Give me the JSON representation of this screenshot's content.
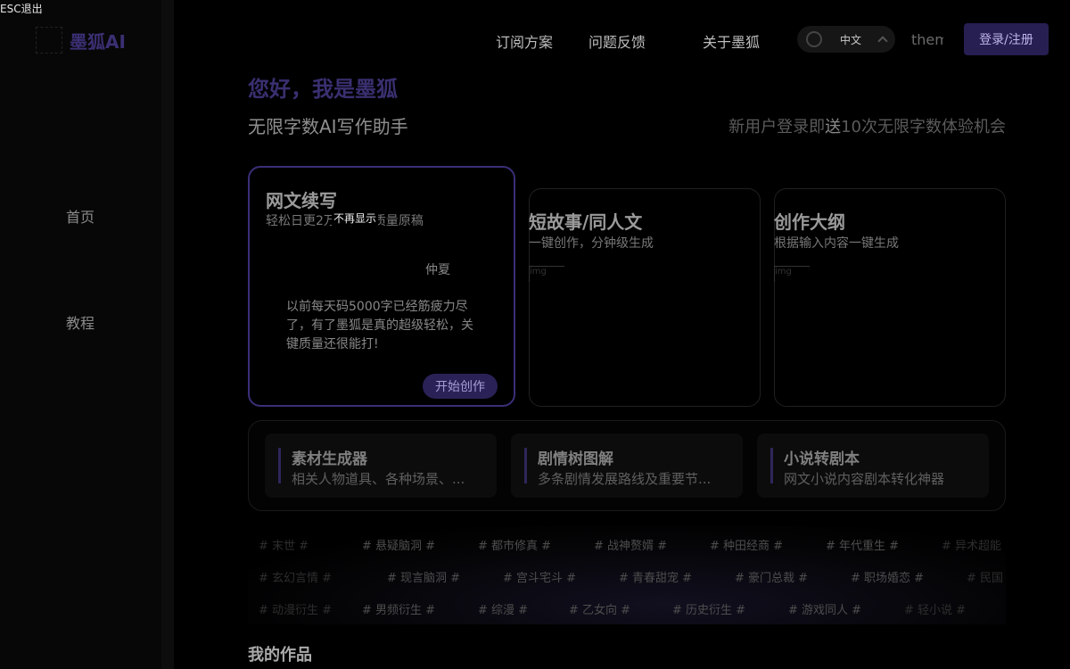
{
  "esc_hint": "ESC退出",
  "brand": {
    "name": "墨狐AI",
    "logo_alt": "logo"
  },
  "sidebar": {
    "items": [
      {
        "label": "首页"
      },
      {
        "label": "教程"
      }
    ]
  },
  "header": {
    "nav": [
      {
        "label": "订阅方案"
      },
      {
        "label": "问题反馈"
      },
      {
        "label": "关于墨狐"
      }
    ],
    "language": "中文",
    "theme_alt": "theme",
    "login_label": "登录/注册"
  },
  "hero": {
    "greeting": "您好，我是墨狐",
    "subtitle": "无限字数AI写作助手",
    "promo_prefix": "新用户登录即",
    "promo_highlight": "送",
    "promo_suffix": "10次无限字数体验机会"
  },
  "cards": [
    {
      "title": "网文续写",
      "subtitle": "轻松日更2万字，高质量原稿",
      "tooltip": "不再显示",
      "author": "仲夏",
      "quote": "以前每天码5000字已经筋疲力尽了，有了墨狐是真的超级轻松，关键质量还很能打!",
      "button": "开始创作"
    },
    {
      "title": "短故事/同人文",
      "subtitle": "一键创作，分钟级生成",
      "img_alt": "img"
    },
    {
      "title": "创作大纲",
      "subtitle": "根据输入内容一键生成",
      "img_alt": "img"
    }
  ],
  "tools": [
    {
      "title": "素材生成器",
      "subtitle": "相关人物道具、各种场景、..."
    },
    {
      "title": "剧情树图解",
      "subtitle": "多条剧情发展路线及重要节..."
    },
    {
      "title": "小说转剧本",
      "subtitle": "网文小说内容剧本转化神器"
    }
  ],
  "tag_rows": [
    [
      "# 末世 #",
      "# 悬疑脑洞 #",
      "# 都市修真 #",
      "# 战神赘婿 #",
      "# 种田经商 #",
      "# 年代重生 #",
      "# 异术超能 #"
    ],
    [
      "# 玄幻言情 #",
      "# 现言脑洞 #",
      "# 宫斗宅斗 #",
      "# 青春甜宠 #",
      "# 豪门总裁 #",
      "# 职场婚恋 #",
      "# 民国 #"
    ],
    [
      "# 动漫衍生 #",
      "# 男频衍生 #",
      "# 综漫 #",
      "# 乙女向 #",
      "# 历史衍生 #",
      "# 游戏同人 #",
      "# 轻小说 #"
    ]
  ],
  "works_heading": "我的作品"
}
